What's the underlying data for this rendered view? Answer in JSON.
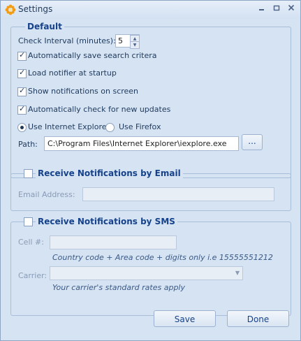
{
  "window": {
    "title": "Settings",
    "minimize_icon": "minimize-icon",
    "restore_icon": "restore-icon",
    "close_icon": "close-icon"
  },
  "default_group": {
    "title": "Default",
    "check_interval_label": "Check Interval (minutes):",
    "check_interval_value": "5",
    "auto_save_label": "Automatically save search critera",
    "auto_save_checked": true,
    "load_notifier_label": "Load notifier at startup",
    "load_notifier_checked": true,
    "show_notifications_label": "Show notifications on screen",
    "show_notifications_checked": true,
    "auto_update_label": "Automatically check for new updates",
    "auto_update_checked": true,
    "browser_ie_label": "Use Internet Explorer",
    "browser_ff_label": "Use Firefox",
    "selected_browser": "Use Internet Explorer",
    "path_label": "Path:",
    "path_value": "C:\\Program Files\\Internet Explorer\\iexplore.exe",
    "browse_label": "..."
  },
  "email_group": {
    "title": "Receive Notifications by Email",
    "enabled": false,
    "address_label": "Email Address:",
    "address_value": ""
  },
  "sms_group": {
    "title": "Receive Notifications by SMS",
    "enabled": false,
    "cell_label": "Cell #:",
    "cell_value": "",
    "cell_hint": "Country code + Area code + digits only i.e 15555551212",
    "carrier_label": "Carrier:",
    "carrier_value": "",
    "carrier_hint": "Your carrier's standard rates apply"
  },
  "footer": {
    "save_label": "Save",
    "done_label": "Done"
  }
}
